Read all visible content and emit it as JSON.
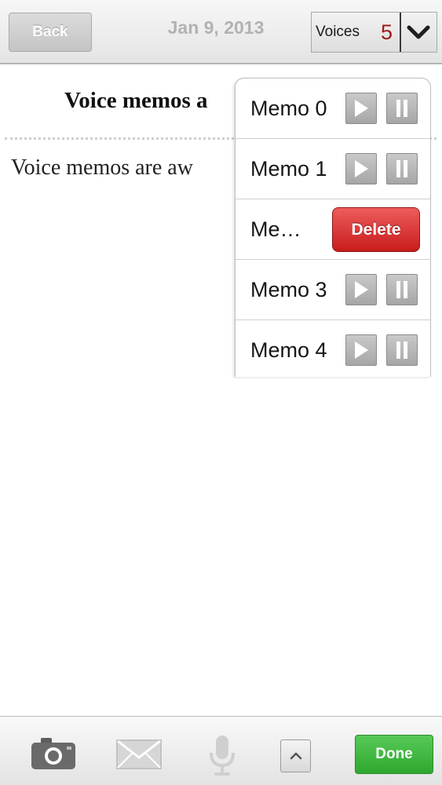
{
  "header": {
    "back_label": "Back",
    "date": "Jan 9, 2013",
    "voices_label": "Voices",
    "voices_count": "5"
  },
  "note": {
    "heading": "Voice memos a",
    "body": "Voice memos are aw"
  },
  "memos": [
    {
      "label": "Memo 0",
      "state": "normal"
    },
    {
      "label": "Memo 1",
      "state": "normal"
    },
    {
      "label": "Me…",
      "state": "delete",
      "delete_label": "Delete"
    },
    {
      "label": "Memo 3",
      "state": "normal"
    },
    {
      "label": "Memo 4",
      "state": "normal"
    }
  ],
  "toolbar": {
    "icons": [
      "camera-icon",
      "mail-icon",
      "microphone-icon",
      "chevron-up-icon"
    ],
    "done_label": "Done"
  },
  "colors": {
    "voices_count": "#9b1b1b",
    "delete_button": "#d42a2a",
    "done_button": "#3cb43c"
  }
}
